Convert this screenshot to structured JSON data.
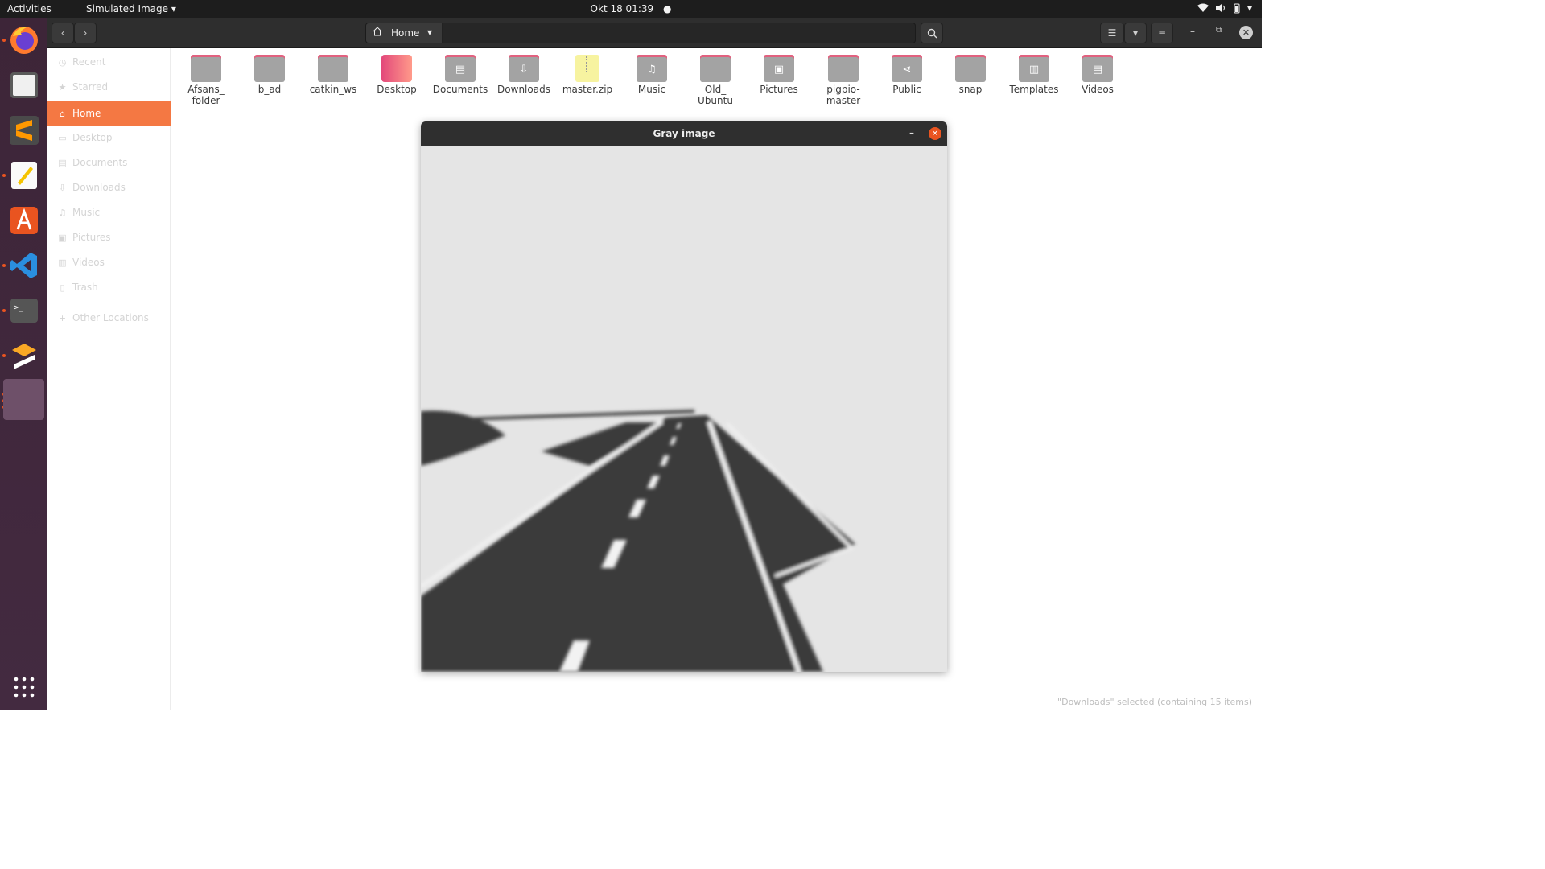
{
  "topbar": {
    "activities": "Activities",
    "app_menu": "Simulated Image",
    "clock": "Okt 18  01:39"
  },
  "dock": {
    "items": [
      {
        "name": "firefox",
        "icon": "firefox-icon",
        "running": true
      },
      {
        "name": "files",
        "icon": "files-icon",
        "running": false
      },
      {
        "name": "sublime-text",
        "icon": "sublime-icon",
        "running": false
      },
      {
        "name": "text-editor",
        "icon": "text-editor-icon",
        "running": true
      },
      {
        "name": "software",
        "icon": "software-center-icon",
        "running": false
      },
      {
        "name": "vscode",
        "icon": "vscode-icon",
        "running": true
      },
      {
        "name": "terminal",
        "icon": "terminal-icon",
        "running": true
      },
      {
        "name": "app",
        "icon": "app-icon",
        "running": true
      },
      {
        "name": "active-window",
        "icon": "window-icon",
        "running": true
      }
    ],
    "show_apps_icon": "grid-icon"
  },
  "header": {
    "path_home": "Home"
  },
  "sidebar": {
    "items": [
      {
        "label": "Recent",
        "icon": "clock-icon"
      },
      {
        "label": "Starred",
        "icon": "star-icon"
      },
      {
        "label": "Home",
        "icon": "home-icon",
        "active": true
      },
      {
        "label": "Desktop",
        "icon": "desktop-icon"
      },
      {
        "label": "Documents",
        "icon": "documents-icon"
      },
      {
        "label": "Downloads",
        "icon": "downloads-icon"
      },
      {
        "label": "Music",
        "icon": "music-icon"
      },
      {
        "label": "Pictures",
        "icon": "pictures-icon"
      },
      {
        "label": "Videos",
        "icon": "videos-icon"
      },
      {
        "label": "Trash",
        "icon": "trash-icon"
      },
      {
        "label": "Other Locations",
        "icon": "plus-icon"
      }
    ]
  },
  "files": [
    {
      "name": "Afsans_\nfolder",
      "type": "folder"
    },
    {
      "name": "b_ad",
      "type": "folder"
    },
    {
      "name": "catkin_ws",
      "type": "folder"
    },
    {
      "name": "Desktop",
      "type": "desktop"
    },
    {
      "name": "Documents",
      "type": "folder",
      "glyph": "▤"
    },
    {
      "name": "Downloads",
      "type": "folder",
      "glyph": "⇩"
    },
    {
      "name": "master.zip",
      "type": "zip"
    },
    {
      "name": "Music",
      "type": "folder",
      "glyph": "♫"
    },
    {
      "name": "Old_\nUbuntu",
      "type": "folder"
    },
    {
      "name": "Pictures",
      "type": "folder",
      "glyph": "▣"
    },
    {
      "name": "pigpio-\nmaster",
      "type": "folder"
    },
    {
      "name": "Public",
      "type": "folder",
      "glyph": "⋖"
    },
    {
      "name": "snap",
      "type": "folder"
    },
    {
      "name": "Templates",
      "type": "folder",
      "glyph": "▥"
    },
    {
      "name": "Videos",
      "type": "folder",
      "glyph": "▤"
    }
  ],
  "image_window": {
    "title": "Gray image"
  },
  "status": "\"Downloads\" selected  (containing 15 items)",
  "colors": {
    "accent": "#f47843",
    "close": "#e95420",
    "road": "#3a3a3a"
  }
}
